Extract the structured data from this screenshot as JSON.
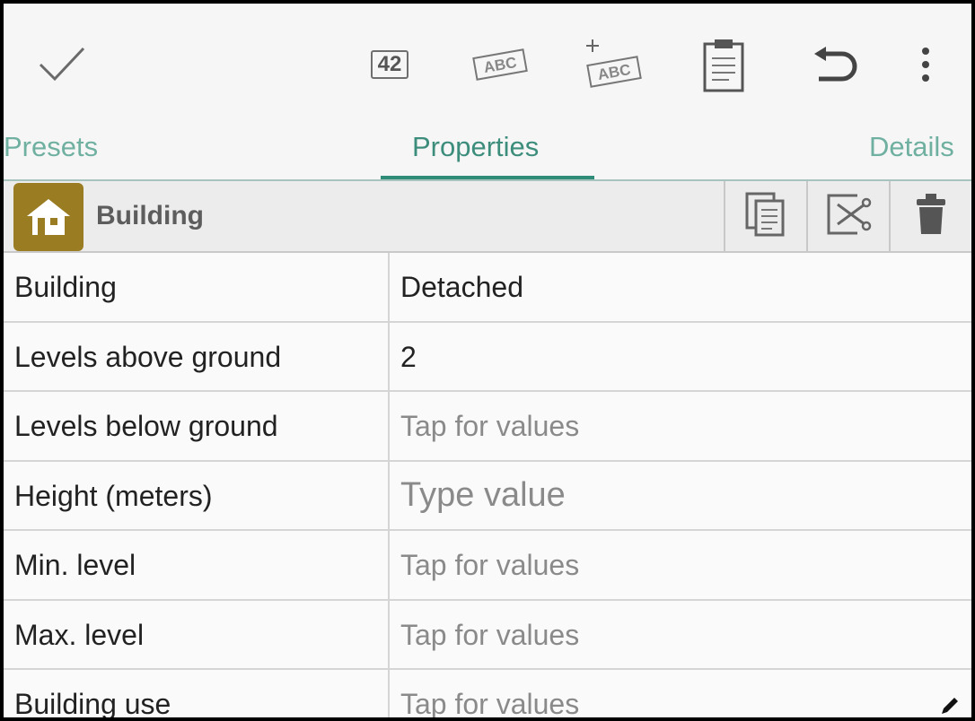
{
  "toolbar": {
    "actions": [
      {
        "name": "done",
        "icon": "checkmark-icon"
      },
      {
        "name": "number",
        "icon": "number-42-icon",
        "label": "42"
      },
      {
        "name": "text",
        "icon": "abc-tag-icon",
        "label": "ABC"
      },
      {
        "name": "add-text",
        "icon": "add-abc-tag-icon",
        "label": "ABC"
      },
      {
        "name": "paste",
        "icon": "clipboard-icon"
      },
      {
        "name": "undo",
        "icon": "undo-icon"
      },
      {
        "name": "more",
        "icon": "more-vert-icon"
      }
    ]
  },
  "tabs": {
    "presets": "Presets",
    "properties": "Properties",
    "details": "Details",
    "active": "properties"
  },
  "preset": {
    "name": "Building",
    "icon": "house-icon",
    "icon_color": "#9a7d22",
    "actions": [
      "copy-icon",
      "cut-icon",
      "delete-icon"
    ]
  },
  "fields": [
    {
      "key": "Building",
      "value": "Detached",
      "filled": true
    },
    {
      "key": "Levels above ground",
      "value": "2",
      "filled": true
    },
    {
      "key": "Levels below ground",
      "value": "Tap for values",
      "filled": false
    },
    {
      "key": "Height (meters)",
      "value": "Type value",
      "filled": false,
      "input": true
    },
    {
      "key": "Min. level",
      "value": "Tap for values",
      "filled": false
    },
    {
      "key": "Max. level",
      "value": "Tap for values",
      "filled": false
    },
    {
      "key": "Building use",
      "value": "Tap for values",
      "filled": false
    }
  ],
  "colors": {
    "accent": "#2f8c78",
    "tab_text": "#6fb0a1",
    "placeholder": "#8a8a8a"
  }
}
